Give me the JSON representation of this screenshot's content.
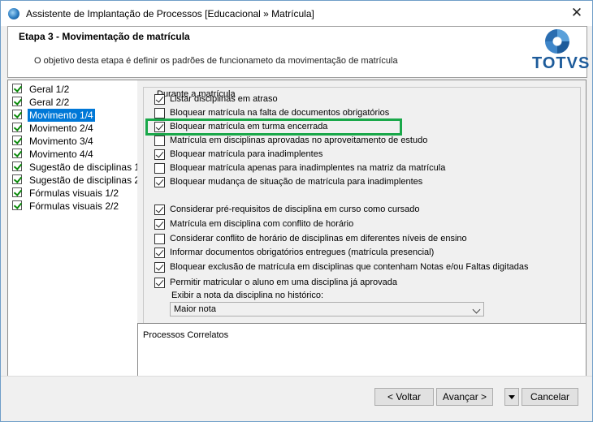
{
  "window": {
    "title": "Assistente de Implantação de Processos [Educacional » Matrícula]",
    "close": "✕"
  },
  "header": {
    "step_title": "Etapa 3 - Movimentação de matrícula",
    "description": "O objetivo desta etapa é definir os padrões de funcionameto da movimentação de matrícula",
    "logo_text": "TOTVS"
  },
  "nav": {
    "items": [
      {
        "label": "Geral 1/2",
        "checked": true
      },
      {
        "label": "Geral 2/2",
        "checked": true
      },
      {
        "label": "Movimento 1/4",
        "checked": true,
        "selected": true
      },
      {
        "label": "Movimento 2/4",
        "checked": true
      },
      {
        "label": "Movimento 3/4",
        "checked": true
      },
      {
        "label": "Movimento 4/4",
        "checked": true
      },
      {
        "label": "Sugestão de disciplinas 1/2",
        "checked": true
      },
      {
        "label": "Sugestão de disciplinas 2/2",
        "checked": true
      },
      {
        "label": "Fórmulas visuais 1/2",
        "checked": true
      },
      {
        "label": "Fórmulas visuais 2/2",
        "checked": true
      }
    ]
  },
  "group": {
    "title": "Durante a matrícula",
    "options": [
      {
        "label": "Listar disciplinas em atraso",
        "checked": true
      },
      {
        "label": "Bloquear matrícula na falta de documentos obrigatórios",
        "checked": false
      },
      {
        "label": "Bloquear matrícula em turma encerrada",
        "checked": true,
        "highlighted": true
      },
      {
        "label": "Matrícula em disciplinas aprovadas no aproveitamento de estudo",
        "checked": false
      },
      {
        "label": "Bloquear matrícula para inadimplentes",
        "checked": true
      },
      {
        "label": "Bloquear matrícula apenas para inadimplentes na matriz da matrícula",
        "checked": false
      },
      {
        "label": "Bloquear mudança de situação de matrícula para inadimplentes",
        "checked": true
      },
      {
        "label": "Considerar pré-requisitos de disciplina em curso como cursado",
        "checked": true
      },
      {
        "label": "Matrícula em disciplina com conflito de horário",
        "checked": true
      },
      {
        "label": "Considerar conflito de horário de disciplinas em diferentes níveis de ensino",
        "checked": false
      },
      {
        "label": "Informar documentos obrigatórios entregues (matrícula presencial)",
        "checked": true
      },
      {
        "label": "Bloquear exclusão de matrícula em disciplinas que contenham Notas e/ou Faltas digitadas",
        "checked": true
      },
      {
        "label": "Permitir matricular o aluno em uma disciplina já aprovada",
        "checked": true
      }
    ],
    "history_caption": "Exibir a nota da disciplina no histórico:",
    "history_select": "Maior nota"
  },
  "related": {
    "label": "Processos Correlatos"
  },
  "buttons": {
    "back": "< Voltar",
    "next": "Avançar >",
    "cancel": "Cancelar"
  }
}
